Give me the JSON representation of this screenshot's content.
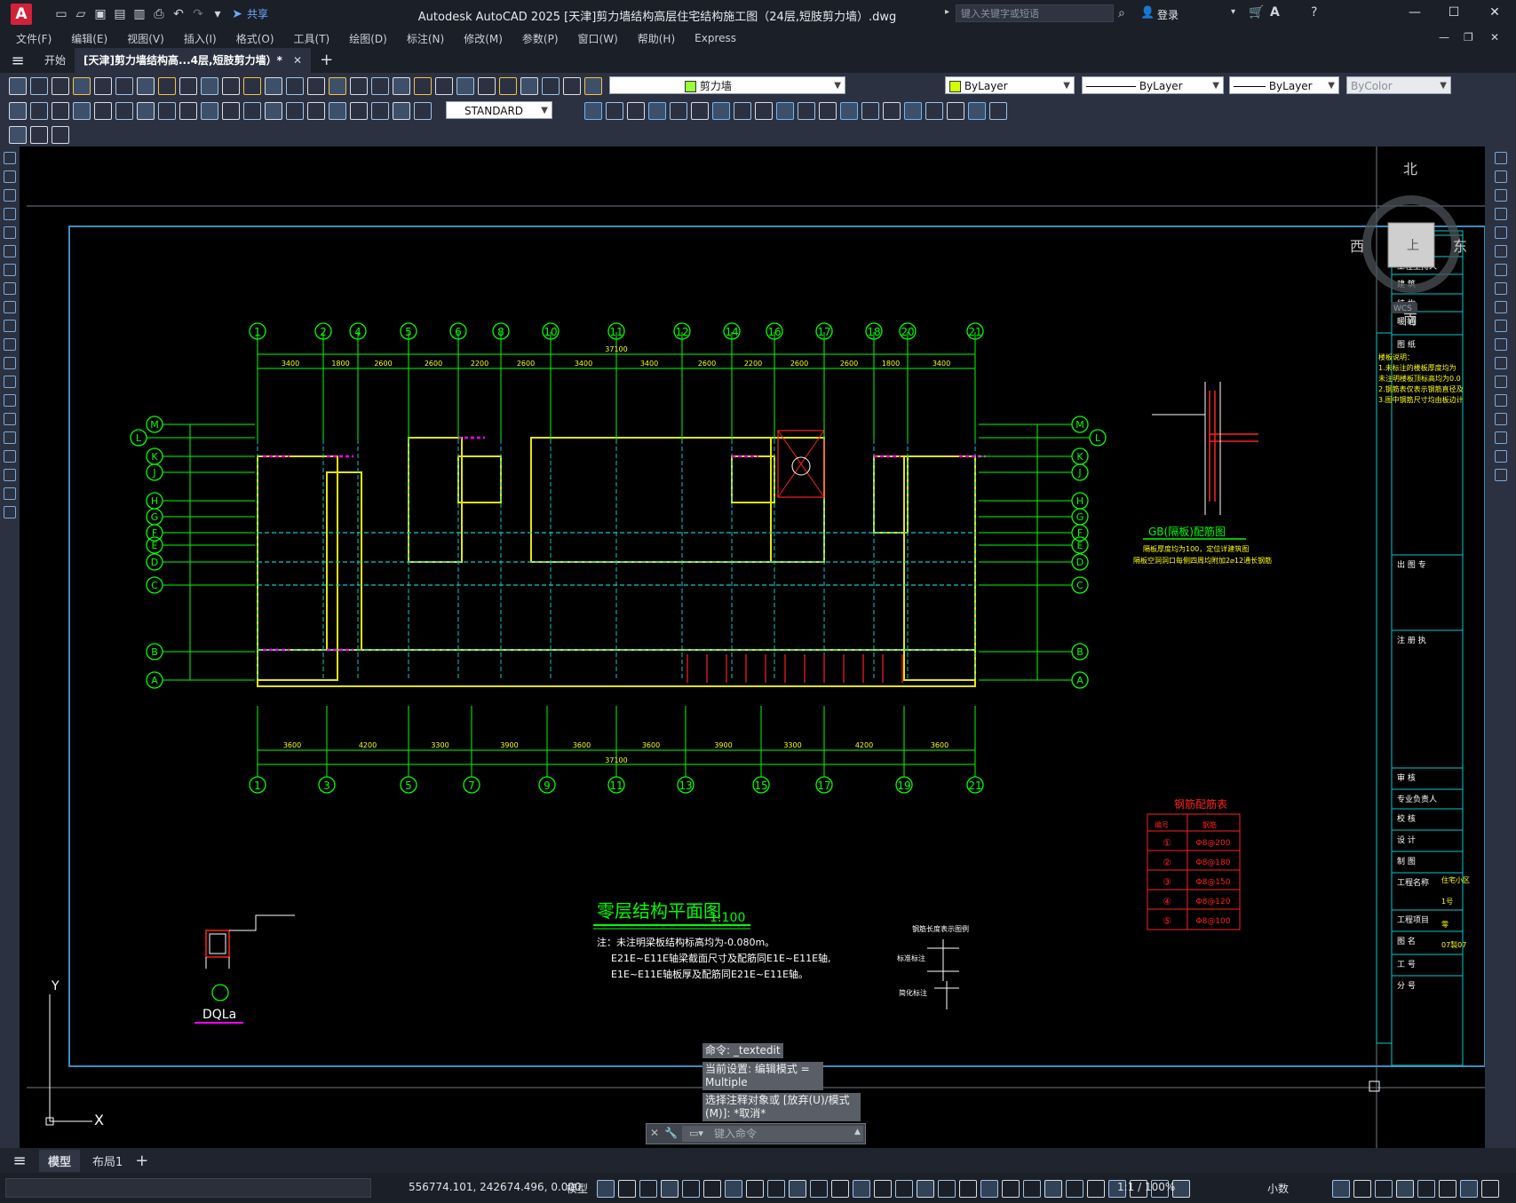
{
  "app": {
    "logo_letter": "A",
    "title": "Autodesk AutoCAD 2025    [天津]剪力墙结构高层住宅结构施工图（24层,短肢剪力墙）.dwg",
    "share_label": "共享",
    "search_placeholder": "键入关键字或短语",
    "login_label": "登录"
  },
  "menu": [
    "文件(F)",
    "编辑(E)",
    "视图(V)",
    "插入(I)",
    "格式(O)",
    "工具(T)",
    "绘图(D)",
    "标注(N)",
    "修改(M)",
    "参数(P)",
    "窗口(W)",
    "帮助(H)",
    "Express"
  ],
  "tabs": {
    "start": "开始",
    "active": "[天津]剪力墙结构高...4层,短肢剪力墙）*",
    "add": "+"
  },
  "properties": {
    "layer": "剪力墙",
    "color": "ByLayer",
    "linetype": "ByLayer",
    "lineweight": "ByLayer",
    "plotstyle": "ByColor",
    "textstyle": "STANDARD"
  },
  "drawing": {
    "axes_top": [
      "1",
      "2",
      "4",
      "5",
      "6",
      "8",
      "10",
      "11",
      "12",
      "14",
      "16",
      "17",
      "18",
      "20",
      "21"
    ],
    "axes_bottom": [
      "1",
      "3",
      "5",
      "7",
      "9",
      "11",
      "13",
      "15",
      "17",
      "19",
      "21"
    ],
    "axes_left": [
      "M",
      "L",
      "K",
      "J",
      "H",
      "G",
      "F",
      "E",
      "D",
      "C",
      "B",
      "A"
    ],
    "dims_top": [
      "3400",
      "1800",
      "2600",
      "2600",
      "2200",
      "2600",
      "3400",
      "3400",
      "2600",
      "2200",
      "2600",
      "2600",
      "1800",
      "3400"
    ],
    "dims_bottom": [
      "3600",
      "4200",
      "3300",
      "3900",
      "3600",
      "3600",
      "3900",
      "3300",
      "4200",
      "3600"
    ],
    "total_width": "37100",
    "main_title": "零层结构平面图",
    "scale": "1:100",
    "notes": [
      "注：未注明梁板结构标高均为-0.080m。",
      "E21E~E11E轴梁截面尺寸及配筋同E1E~E11E轴,",
      "E1E~E11E轴板厚及配筋同E21E~E11E轴。"
    ],
    "detail_name": "DQLa",
    "gb_title": "GB(隔板)配筋图",
    "gb_notes": [
      "隔板厚度均为100，定位详建筑图",
      "隔板空洞洞口每侧四周均附加2⌀12通长钢筋"
    ],
    "rebar_table": {
      "title": "钢筋配筋表",
      "headers": [
        "编号",
        "钢筋"
      ],
      "rows": [
        [
          "①",
          "Φ8@200"
        ],
        [
          "②",
          "Φ8@180"
        ],
        [
          "③",
          "Φ8@150"
        ],
        [
          "④",
          "Φ8@120"
        ],
        [
          "⑤",
          "Φ8@100"
        ]
      ]
    },
    "legend": {
      "title": "钢筋长度表示图例",
      "label1": "标准标注",
      "label2": "简化标注"
    },
    "titleblock": [
      "会签",
      "工程主持人",
      "建 筑",
      "结 构",
      "暖 通",
      "图 纸",
      "出 图 专",
      "注 册 执",
      "审 核",
      "专业负责人",
      "校 核",
      "设 计",
      "制 图",
      "工程名称",
      "工程项目",
      "图 名",
      "工 号",
      "分 号"
    ],
    "titleblock_values": [
      "住宅小区",
      "1号",
      "零",
      "07製07"
    ],
    "titleblock_notes": [
      "楼板说明：",
      "1.未标注的楼板厚度均为",
      "  未注明楼板顶标高均为0.0",
      "2.钢筋表仅表示钢筋直径及",
      "3.图中钢筋尺寸均由板边计"
    ]
  },
  "viewcube": {
    "n": "北",
    "s": "南",
    "e": "东",
    "w": "西",
    "top": "上",
    "wcs": "WCS"
  },
  "ucs": {
    "x": "X",
    "y": "Y"
  },
  "command": {
    "lines": [
      "命令: _textedit",
      "当前设置: 编辑模式 = Multiple",
      "选择注释对象或 [放弃(U)/模式(M)]: *取消*"
    ],
    "placeholder": "键入命令"
  },
  "layout_tabs": [
    "模型",
    "布局1"
  ],
  "status": {
    "coords": "556774.101, 242674.496, 0.000",
    "model": "模型",
    "scale": "1:1 / 100%",
    "units": "小数"
  },
  "colors": {
    "canvas": "#000000",
    "axis_green": "#00ff00",
    "wall_yellow": "#e6e600",
    "beam_cyan": "#00cccc",
    "magenta": "#ff00ff",
    "red": "#ff2020",
    "frame_blue": "#3a8fc0"
  }
}
